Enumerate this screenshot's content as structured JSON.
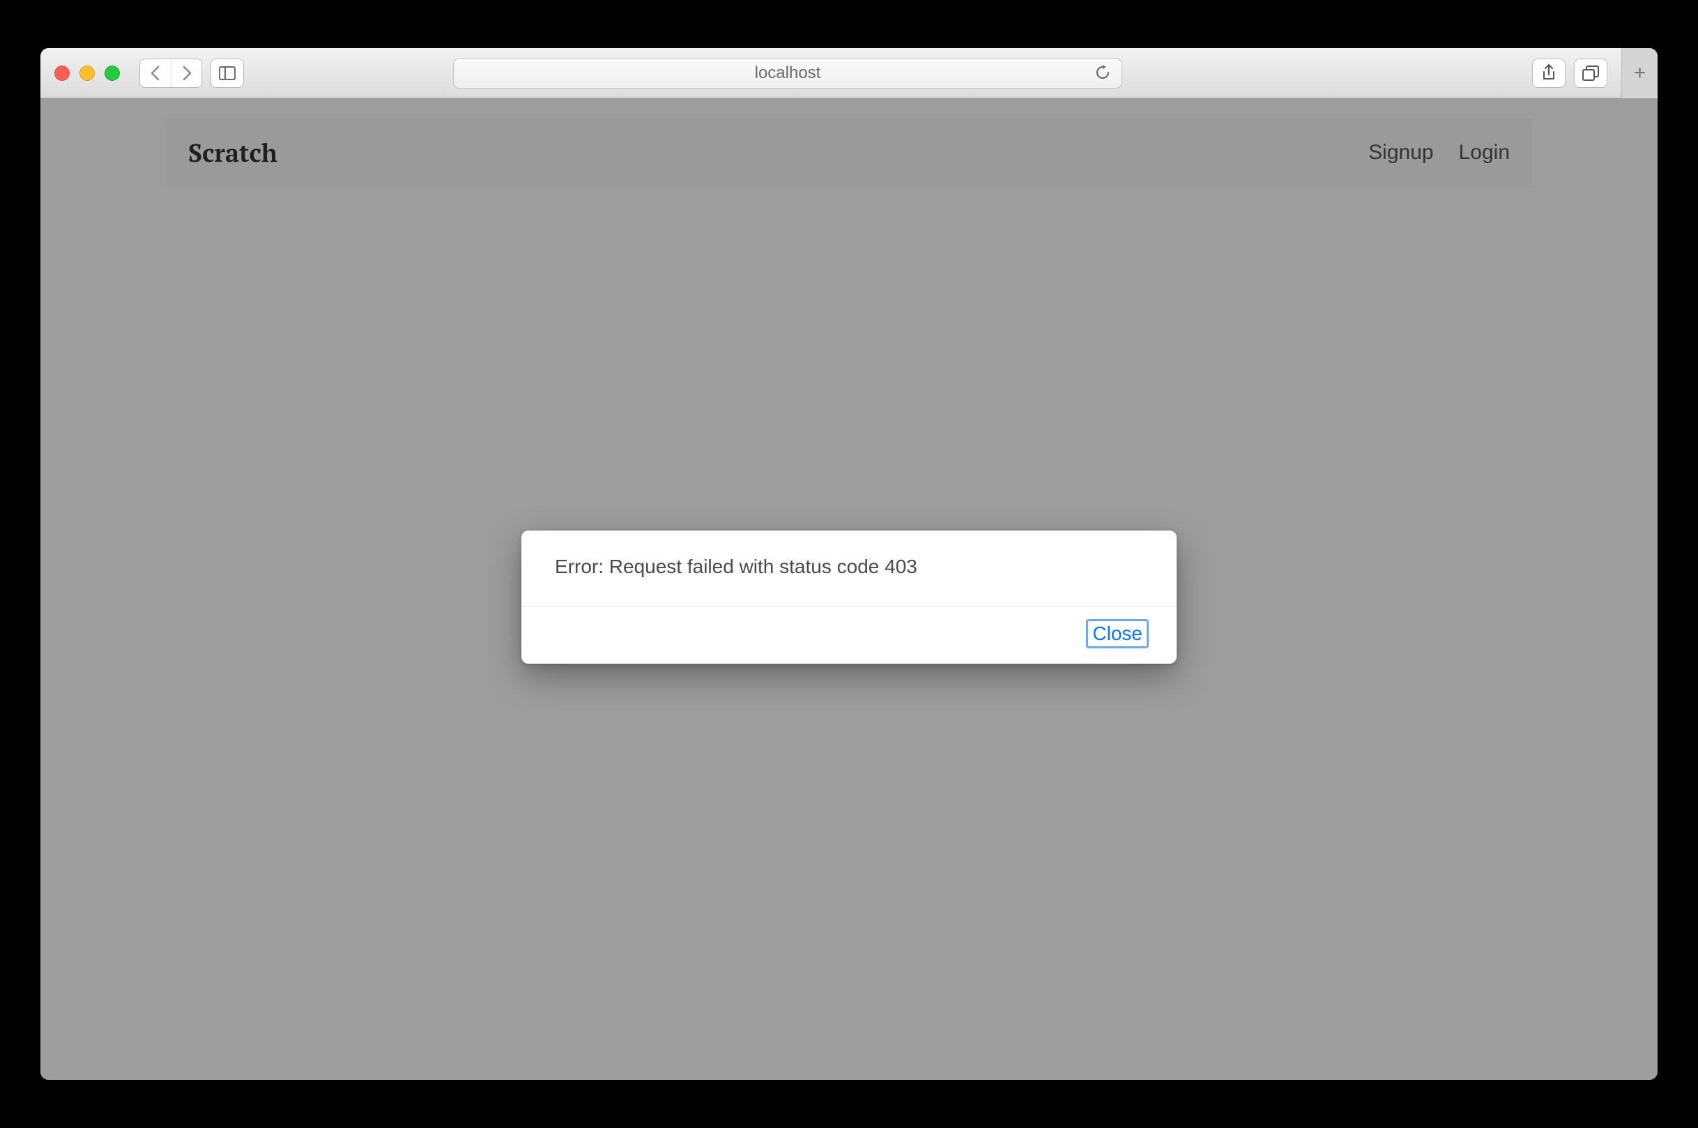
{
  "browser": {
    "address": "localhost"
  },
  "navbar": {
    "brand": "Scratch",
    "links": {
      "signup": "Signup",
      "login": "Login"
    }
  },
  "dialog": {
    "message": "Error: Request failed with status code 403",
    "close_label": "Close"
  }
}
